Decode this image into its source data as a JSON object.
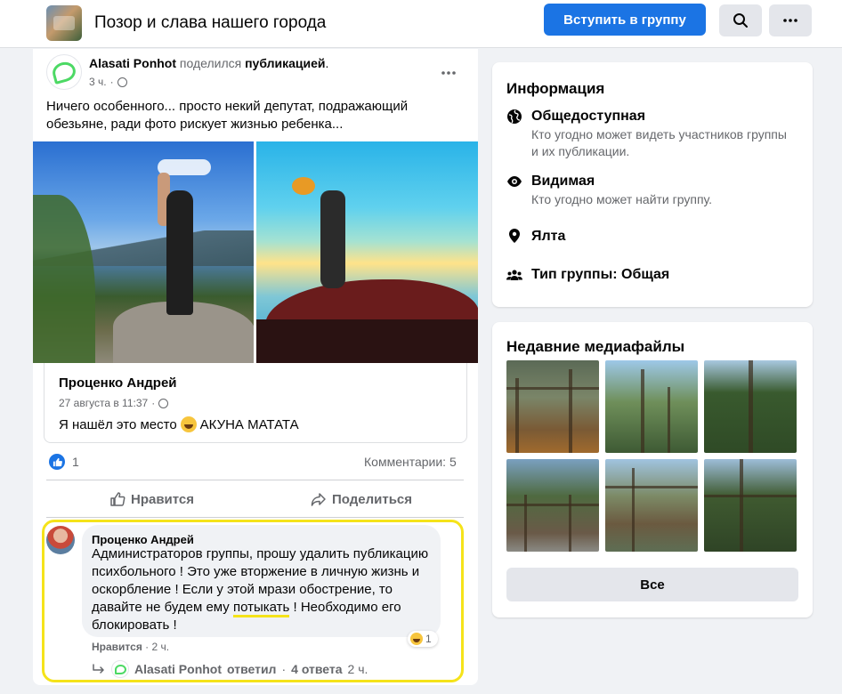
{
  "header": {
    "group_name": "Позор и слава нашего города",
    "join_button": "Вступить в группу",
    "search_icon": "search-icon",
    "more_icon": "more-dots-icon"
  },
  "post": {
    "sharer_name": "Alasati Ponhot",
    "shared_verb": "поделился",
    "shared_object": "публикацией",
    "shared_dot": ".",
    "time": "3 ч.",
    "dot_sep": "·",
    "text": "Ничего особенного... просто некий депутат,  подражающий обезьяне,  ради фото рискует жизнью ребенка...",
    "inner": {
      "author": "Проценко Андрей",
      "time": "27 августа в 11:37",
      "text": "Я нашёл это место",
      "text_after": "АКУНА МАТАТА"
    },
    "reactions_count": "1",
    "comments_count": "Комментарии: 5",
    "like_action": "Нравится",
    "share_action": "Поделиться"
  },
  "comment": {
    "author": "Проценко Андрей",
    "text_before": "Администраторов группы, прошу удалить публикацию психбольного ! Это уже вторжение в личную жизнь и оскорбление ! Если у этой мрази обострение, то давайте не будем ему ",
    "text_highlight": "потыкать",
    "text_after": " ! Необходимо его блокировать !",
    "reaction_count": "1",
    "like_label": "Нравится",
    "dot_sep": "·",
    "time": "2 ч.",
    "reply_author": "Alasati Ponhot",
    "reply_text": "ответил",
    "reply_count": "4 ответа",
    "reply_time": "2 ч."
  },
  "info": {
    "title": "Информация",
    "rows": [
      {
        "icon": "globe-icon",
        "title": "Общедоступная",
        "sub": "Кто угодно может видеть участников группы и их публикации."
      },
      {
        "icon": "eye-icon",
        "title": "Видимая",
        "sub": "Кто угодно может найти группу."
      },
      {
        "icon": "location-pin-icon",
        "title": "Ялта",
        "sub": ""
      },
      {
        "icon": "group-people-icon",
        "title": "Тип группы: Общая",
        "sub": ""
      }
    ]
  },
  "media": {
    "title": "Недавние медиафайлы",
    "all_button": "Все"
  },
  "colors": {
    "brand_blue": "#1b74e4",
    "highlight_yellow": "#f5e31a",
    "muted_text": "#65676b"
  }
}
